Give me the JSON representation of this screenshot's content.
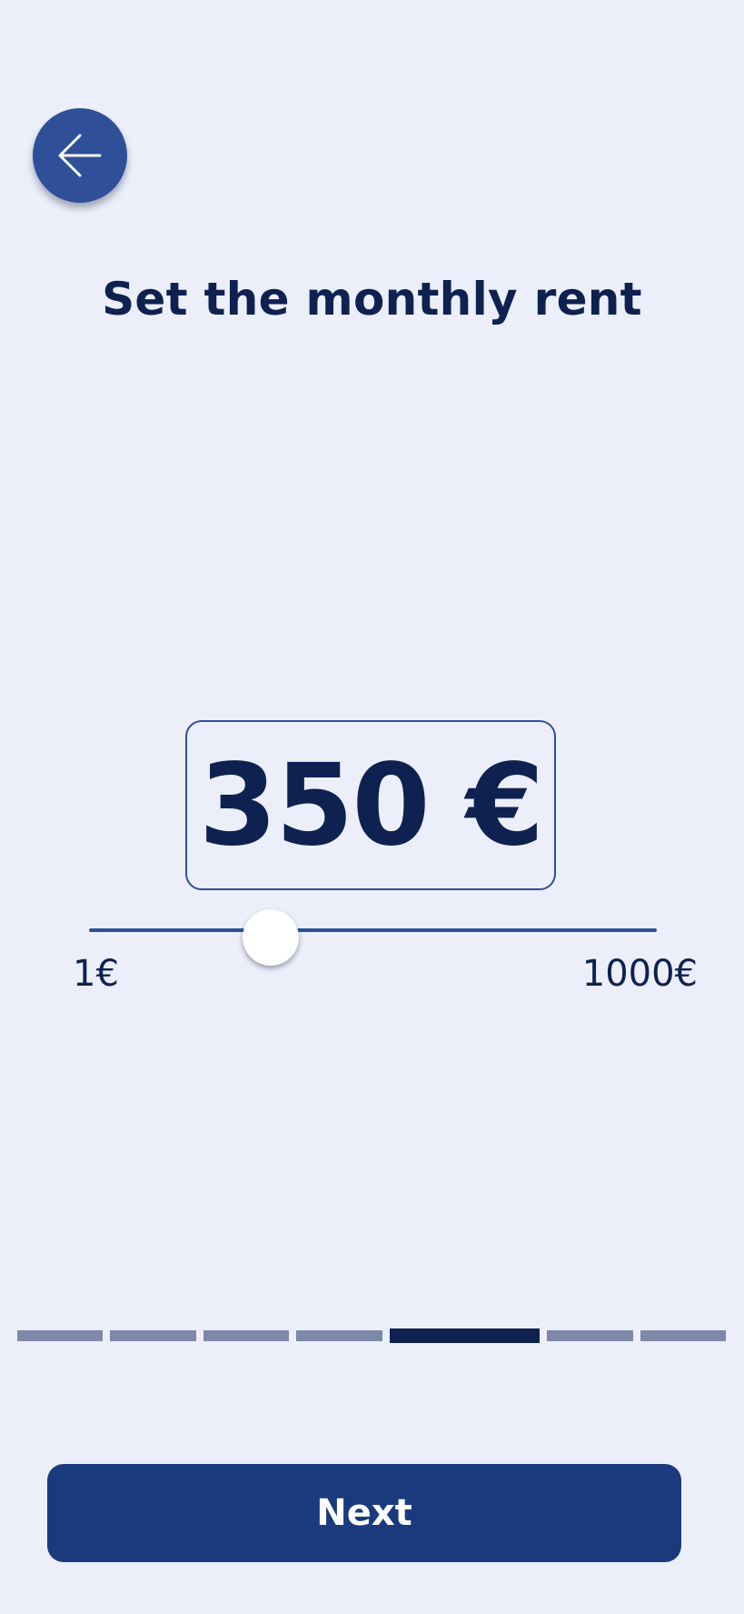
{
  "header": {
    "back_icon": "arrow-left-icon"
  },
  "page": {
    "title": "Set the monthly rent"
  },
  "rent": {
    "amount_display": "350 €",
    "value": 350,
    "min": 1,
    "max": 1000,
    "min_label": "1€",
    "max_label": "1000€",
    "slider_fraction": 0.32
  },
  "progress": {
    "total_steps": 7,
    "current_step": 5
  },
  "footer": {
    "next_label": "Next"
  },
  "colors": {
    "background": "#eceffa",
    "primary": "#2f4f99",
    "button": "#1b3a7e",
    "text": "#0e2150",
    "step_inactive": "#7d89a8"
  }
}
